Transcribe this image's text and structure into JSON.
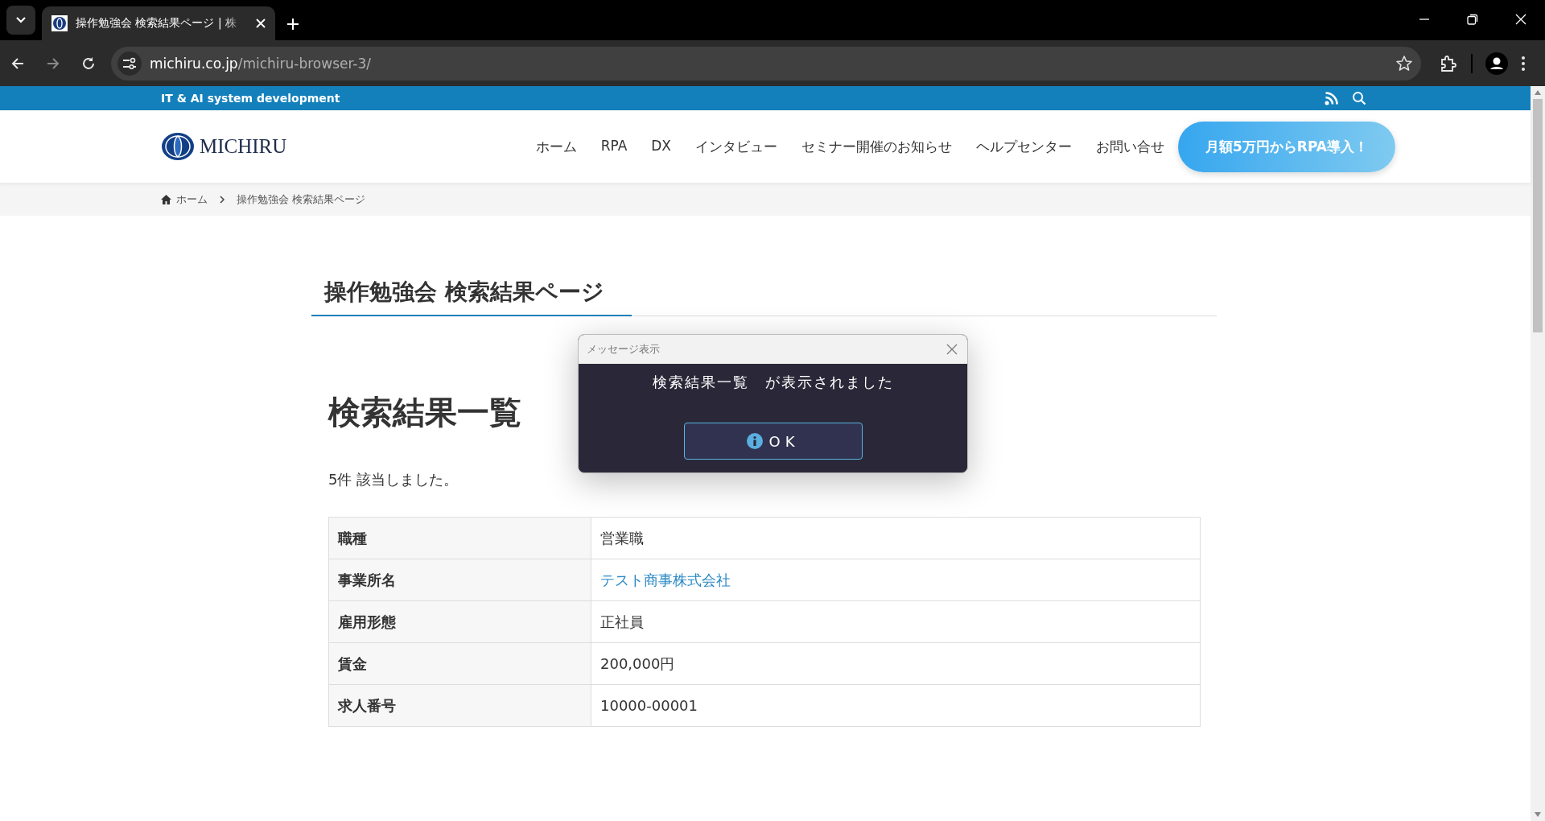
{
  "browser": {
    "tabs": [
      {
        "title": "操作勉強会 検索結果ページ | 株",
        "selected": true
      }
    ],
    "url_host": "michiru.co.jp",
    "url_path": "/michiru-browser-3/"
  },
  "topbar": {
    "tagline": "IT & AI system development"
  },
  "header": {
    "logo": "MICHIRU",
    "nav": [
      "ホーム",
      "RPA",
      "DX",
      "インタビュー",
      "セミナー開催のお知らせ",
      "ヘルプセンター",
      "お問い合せ"
    ],
    "cta": "月額5万円からRPA導入！"
  },
  "breadcrumb": [
    "ホーム",
    "操作勉強会 検索結果ページ"
  ],
  "page_title": "操作勉強会 検索結果ページ",
  "section_heading": "検索結果一覧",
  "result_count": "5件 該当しました。",
  "table": {
    "rows": [
      {
        "label": "職種",
        "value": "営業職",
        "kind": "text"
      },
      {
        "label": "事業所名",
        "value": "テスト商事株式会社",
        "kind": "link"
      },
      {
        "label": "雇用形態",
        "value": "正社員",
        "kind": "text"
      },
      {
        "label": "賃金",
        "value": "200,000円",
        "kind": "text"
      },
      {
        "label": "求人番号",
        "value": "10000-00001",
        "kind": "text"
      }
    ]
  },
  "dialog": {
    "title": "メッセージ表示",
    "message": "検索結果一覧　が表示されました",
    "button": "OK"
  }
}
